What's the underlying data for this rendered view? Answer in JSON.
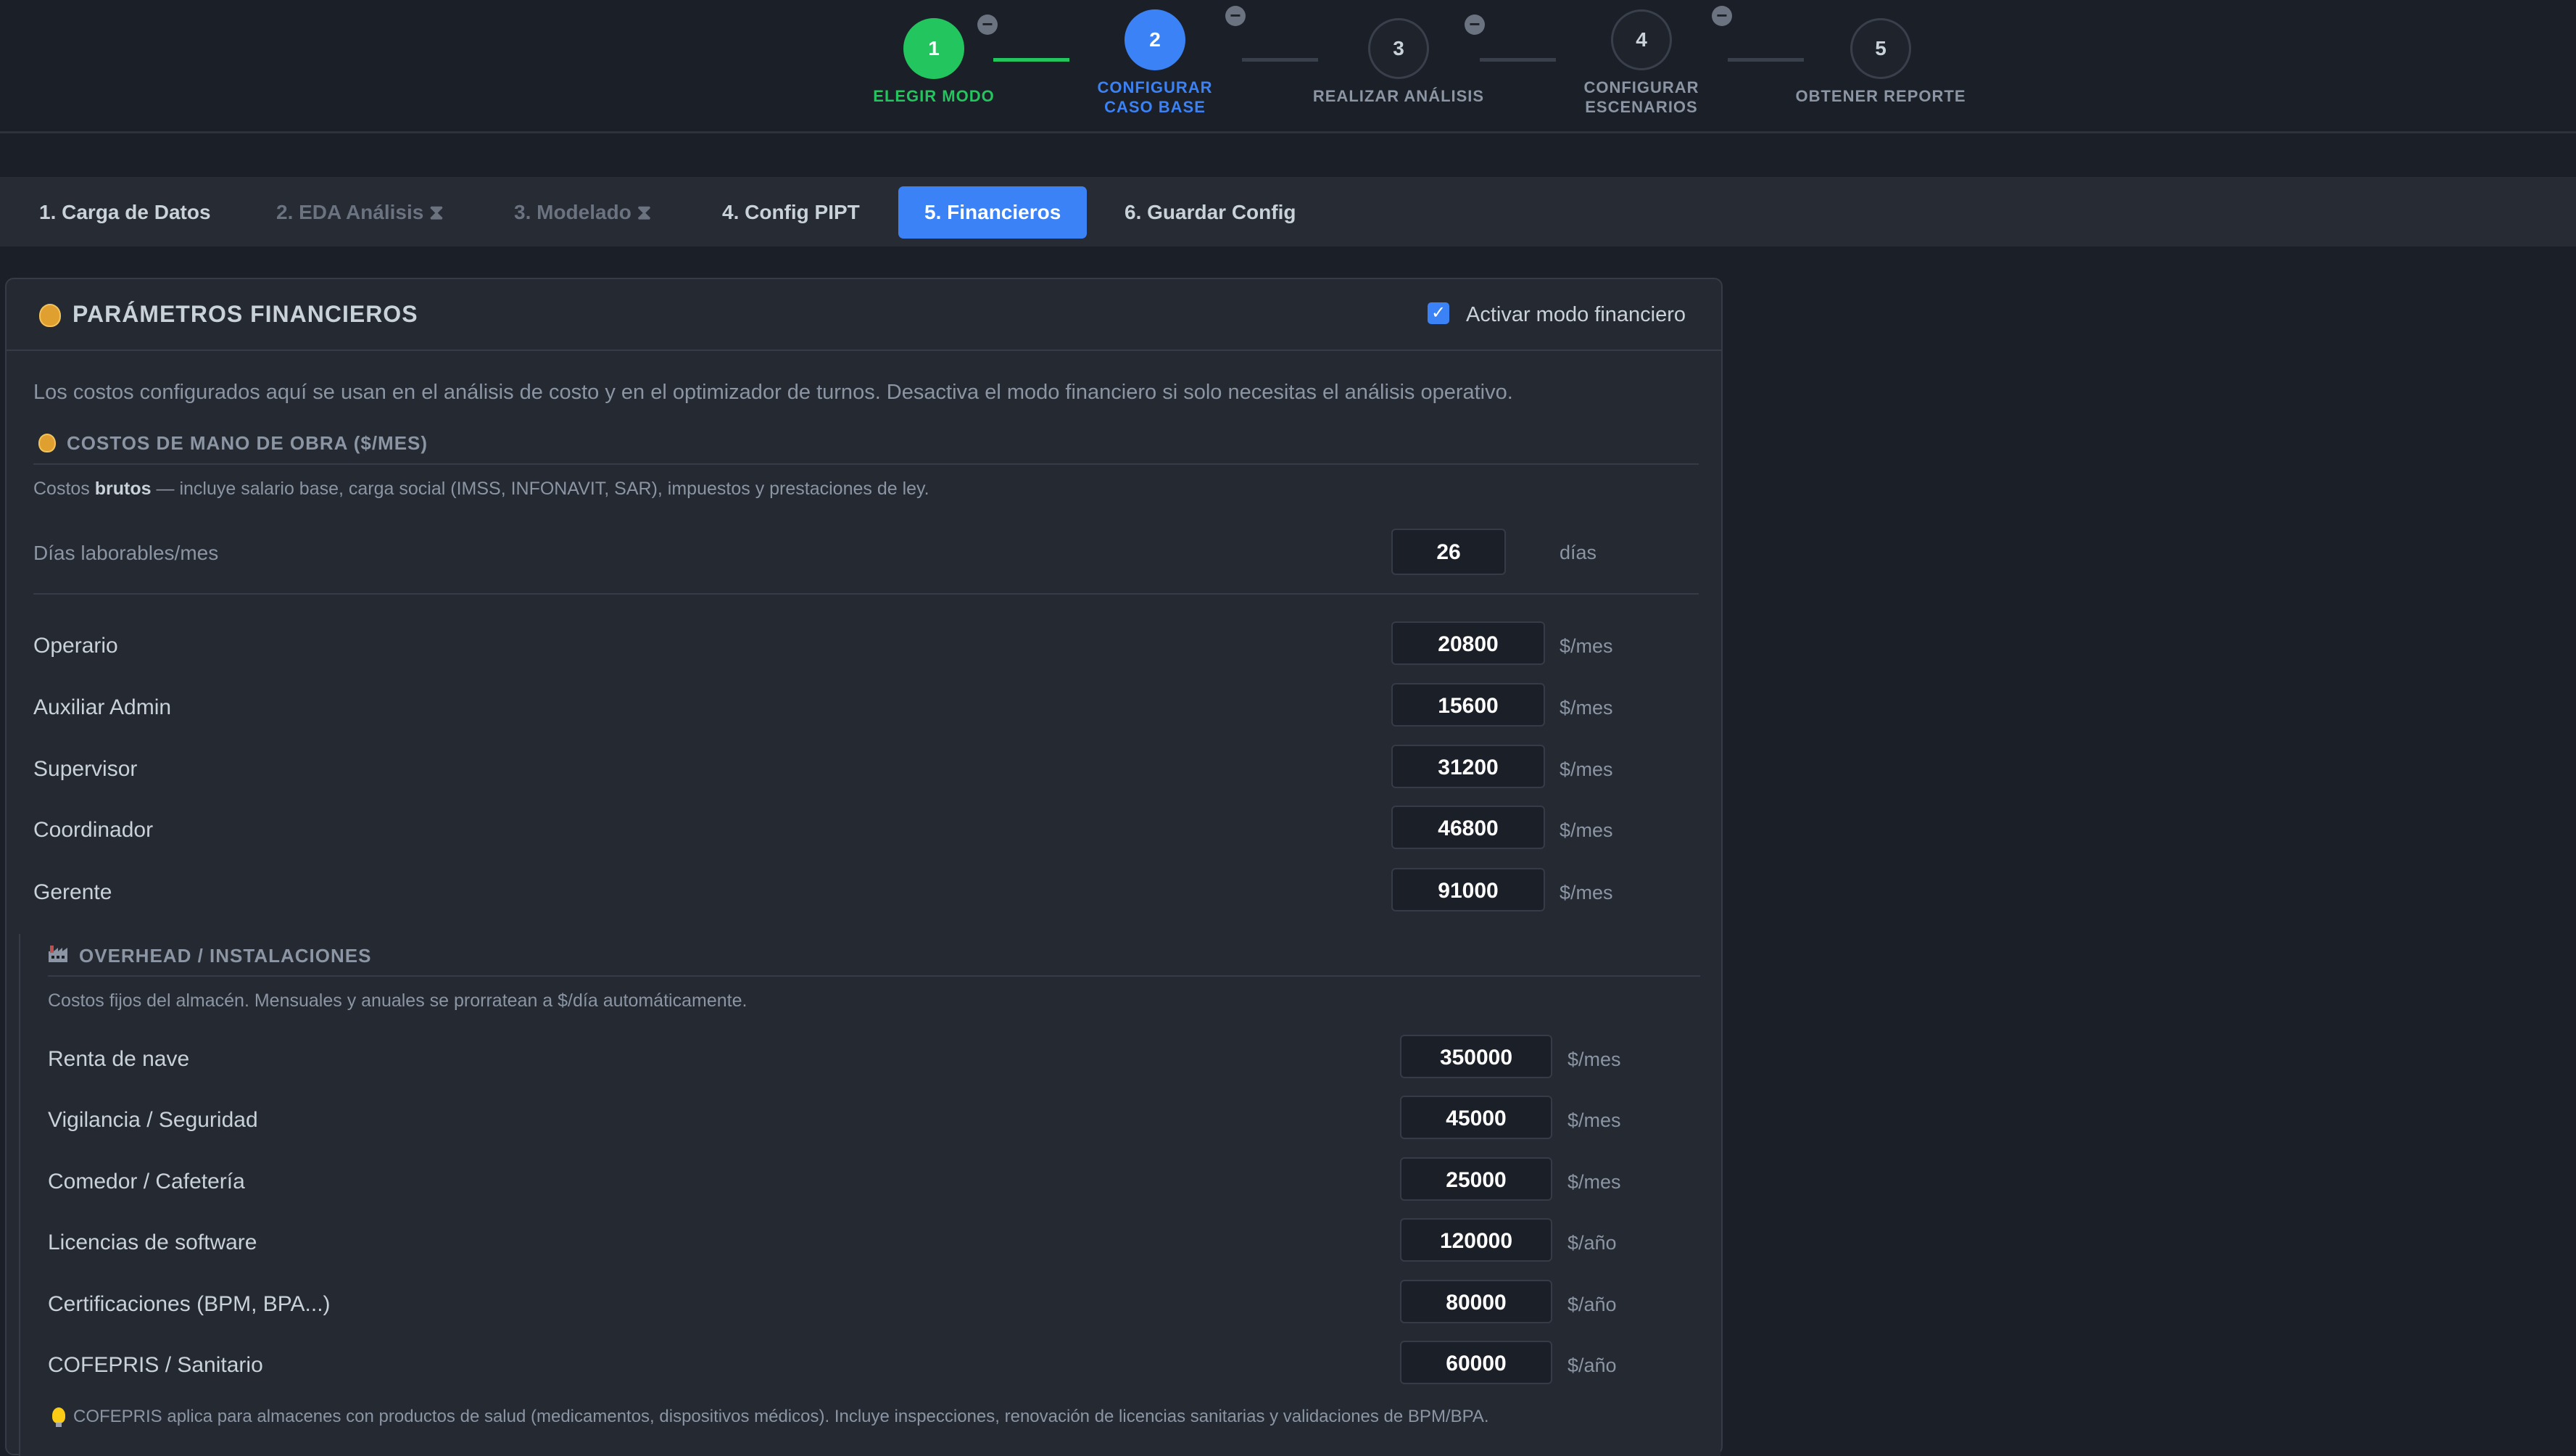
{
  "stepper": {
    "steps": [
      {
        "number": "1",
        "label": "ELEGIR MODO",
        "state": "done"
      },
      {
        "number": "2",
        "label": "CONFIGURAR CASO BASE",
        "state": "active"
      },
      {
        "number": "3",
        "label": "REALIZAR ANÁLISIS",
        "state": "pending"
      },
      {
        "number": "4",
        "label": "CONFIGURAR ESCENARIOS",
        "state": "pending"
      },
      {
        "number": "5",
        "label": "OBTENER REPORTE",
        "state": "pending"
      }
    ],
    "minus_glyph": "−"
  },
  "tabs": [
    {
      "label": "1. Carga de Datos",
      "state": "normal"
    },
    {
      "label": "2. EDA Análisis ⧗",
      "state": "disabled"
    },
    {
      "label": "3. Modelado ⧗",
      "state": "disabled"
    },
    {
      "label": "4. Config PIPT",
      "state": "normal"
    },
    {
      "label": "5. Financieros",
      "state": "active"
    },
    {
      "label": "6. Guardar Config",
      "state": "normal"
    }
  ],
  "panel": {
    "title": "PARÁMETROS FINANCIEROS",
    "toggle_label": "Activar modo financiero",
    "toggle_checked": true,
    "intro": "Los costos configurados aquí se usan en el análisis de costo y en el optimizador de turnos. Desactiva el modo financiero si solo necesitas el análisis operativo."
  },
  "labor": {
    "title": "COSTOS DE MANO DE OBRA ($/MES)",
    "note_prefix": "Costos ",
    "note_bold": "brutos",
    "note_suffix": " — incluye salario base, carga social (IMSS, INFONAVIT, SAR), impuestos y prestaciones de ley.",
    "workdays": {
      "label": "Días laborables/mes",
      "value": "26",
      "unit": "días"
    },
    "roles": [
      {
        "label": "Operario",
        "value": "20800",
        "unit": "$/mes"
      },
      {
        "label": "Auxiliar Admin",
        "value": "15600",
        "unit": "$/mes"
      },
      {
        "label": "Supervisor",
        "value": "31200",
        "unit": "$/mes"
      },
      {
        "label": "Coordinador",
        "value": "46800",
        "unit": "$/mes"
      },
      {
        "label": "Gerente",
        "value": "91000",
        "unit": "$/mes"
      }
    ]
  },
  "overhead": {
    "title": "OVERHEAD / INSTALACIONES",
    "note": "Costos fijos del almacén. Mensuales y anuales se prorratean a $/día automáticamente.",
    "items": [
      {
        "label": "Renta de nave",
        "value": "350000",
        "unit": "$/mes"
      },
      {
        "label": "Vigilancia / Seguridad",
        "value": "45000",
        "unit": "$/mes"
      },
      {
        "label": "Comedor / Cafetería",
        "value": "25000",
        "unit": "$/mes"
      },
      {
        "label": "Licencias de software",
        "value": "120000",
        "unit": "$/año"
      },
      {
        "label": "Certificaciones (BPM, BPA...)",
        "value": "80000",
        "unit": "$/año"
      },
      {
        "label": "COFEPRIS / Sanitario",
        "value": "60000",
        "unit": "$/año"
      }
    ],
    "footnote": "COFEPRIS aplica para almacenes con productos de salud (medicamentos, dispositivos médicos). Incluye inspecciones, renovación de licencias sanitarias y validaciones de BPM/BPA."
  },
  "colors": {
    "accent": "#3b82f6",
    "success": "#22c55e",
    "background": "#1b1f27",
    "panel": "#242932"
  },
  "icons": {
    "panel_title": "money-bag-icon",
    "labor_title": "money-bag-icon",
    "overhead_title": "factory-icon",
    "footnote": "lightbulb-icon"
  }
}
